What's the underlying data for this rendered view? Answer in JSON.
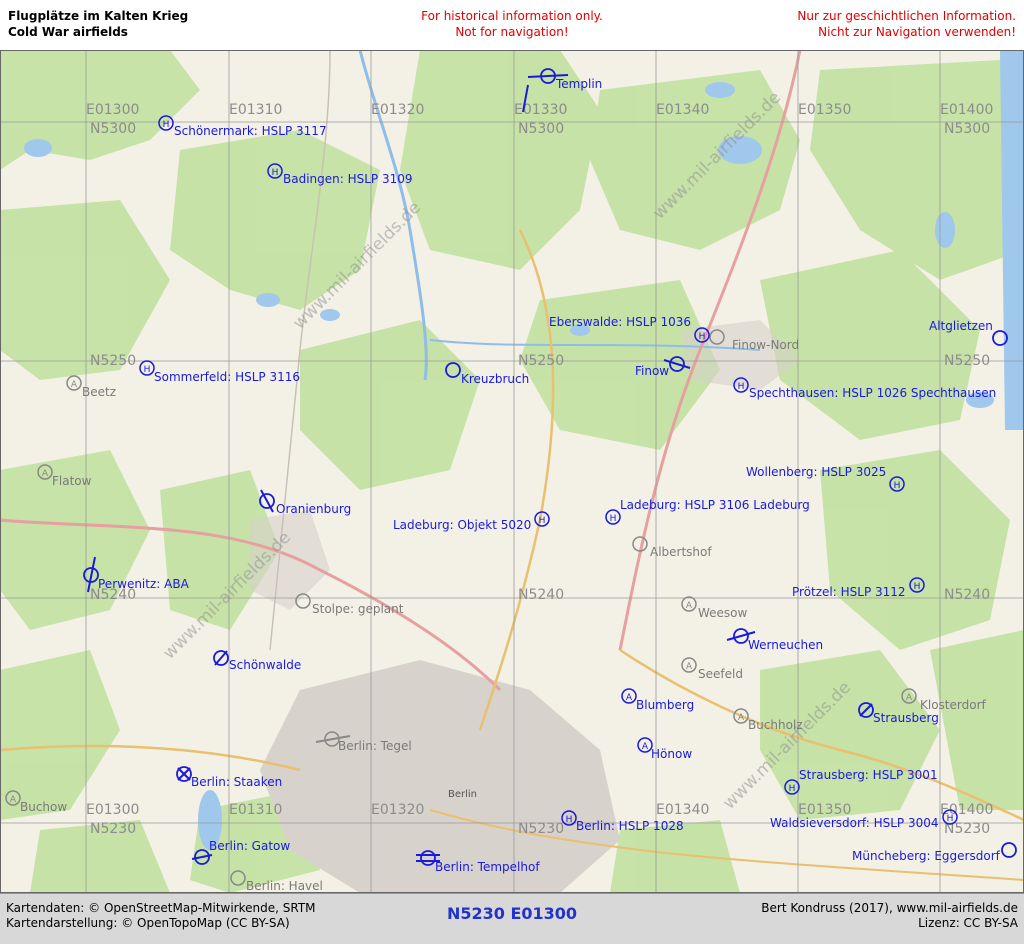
{
  "header": {
    "title_de": "Flugplätze im Kalten Krieg",
    "title_en": "Cold War airfields",
    "warning_en_1": "For historical information only.",
    "warning_en_2": "Not for navigation!",
    "warning_de_1": "Nur zur geschichtlichen Information.",
    "warning_de_2": "Nicht zur Navigation verwenden!"
  },
  "footer": {
    "credit_data": "Kartendaten: © OpenStreetMap-Mitwirkende, SRTM",
    "credit_style": "Kartendarstellung: © OpenTopoMap (CC BY-SA)",
    "sheet": "N5230 E01300",
    "author": "Bert Kondruss (2017), www.mil-airfields.de",
    "license": "Lizenz: CC BY-SA"
  },
  "map": {
    "watermark": "www.mil-airfields.de",
    "grid_labels": {
      "e01300": "E01300",
      "e01310": "E01310",
      "e01320": "E01320",
      "e01330": "E01330",
      "e01340": "E01340",
      "e01350": "E01350",
      "e01400": "E01400",
      "n5300": "N5300",
      "n5250": "N5250",
      "n5240": "N5240",
      "n5230": "N5230"
    },
    "places": {
      "finow_nord": "Finow-Nord",
      "albertshof": "Albertshof",
      "weesow": "Weesow",
      "seefeld": "Seefeld",
      "buchholz": "Buchholz",
      "klosterdorf": "Klosterdorf",
      "stolpe": "Stolpe: geplant",
      "beetz": "Beetz",
      "flatow": "Flatow",
      "buchow": "Buchow",
      "berlin": "Berlin",
      "berlin_tegel": "Berlin: Tegel",
      "berlin_havel": "Berlin: Havel"
    },
    "airfields": {
      "templin": "Templin",
      "schoenermark": "Schönermark: HSLP 3117",
      "badingen": "Badingen: HSLP 3109",
      "eberswalde": "Eberswalde: HSLP 1036",
      "altglietzen": "Altglietzen",
      "sommerfeld": "Sommerfeld: HSLP 3116",
      "kreuzbruch": "Kreuzbruch",
      "finow": "Finow",
      "spechthausen": "Spechthausen: HSLP 1026 Spechthausen",
      "wollenberg": "Wollenberg: HSLP 3025",
      "oranienburg": "Oranienburg",
      "ladeburg_objekt": "Ladeburg: Objekt 5020",
      "ladeburg_hslp": "Ladeburg: HSLP 3106 Ladeburg",
      "perwenitz": "Perwenitz: ABA",
      "proetzel": "Prötzel: HSLP 3112",
      "werneuchen": "Werneuchen",
      "schoenwalde": "Schönwalde",
      "blumberg": "Blumberg",
      "strausberg": "Strausberg",
      "hoenow": "Hönow",
      "berlin_staaken": "Berlin: Staaken",
      "strausberg_hslp": "Strausberg: HSLP 3001",
      "berlin_hslp": "Berlin: HSLP 1028",
      "waldsieversdorf": "Waldsieversdorf: HSLP 3004",
      "berlin_gatow": "Berlin: Gatow",
      "berlin_tempelhof": "Berlin: Tempelhof",
      "muencheberg": "Müncheberg: Eggersdorf"
    },
    "colors": {
      "airfield": "#1a1adb",
      "place": "#8a8a8a",
      "grid_label": "#8c8c8c",
      "land": "#f4f1e8",
      "forest": "#c5e3a5",
      "urban": "#d9d4ce"
    }
  }
}
